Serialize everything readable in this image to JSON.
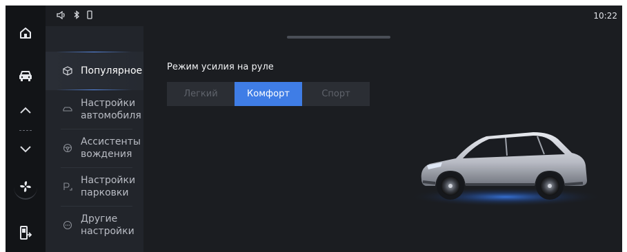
{
  "status_bar": {
    "time": "10:22",
    "icons": [
      "volume-icon",
      "bluetooth-icon",
      "battery-icon"
    ]
  },
  "rail": {
    "buttons": [
      "home-icon",
      "car-icon",
      "chevron-up-icon",
      "chevron-down-icon",
      "fan-icon",
      "exit-icon"
    ]
  },
  "menu": {
    "items": [
      {
        "label": "Популярное",
        "icon": "cube-icon",
        "active": true
      },
      {
        "label": "Настройки автомобиля",
        "icon": "car-outline-icon",
        "active": false
      },
      {
        "label": "Ассистенты вождения",
        "icon": "steering-wheel-icon",
        "active": false
      },
      {
        "label": "Настройки парковки",
        "icon": "parking-icon",
        "active": false
      },
      {
        "label": "Другие настройки",
        "icon": "more-icon",
        "active": false
      }
    ]
  },
  "steering": {
    "title": "Режим усилия на руле",
    "options": [
      "Легкий",
      "Комфорт",
      "Спорт"
    ],
    "selected": "Комфорт"
  },
  "colors": {
    "accent": "#3f7de6",
    "background": "#1b1d21",
    "rail": "#121417",
    "menu": "#22252b",
    "car_glow": "#2f6fe0"
  }
}
